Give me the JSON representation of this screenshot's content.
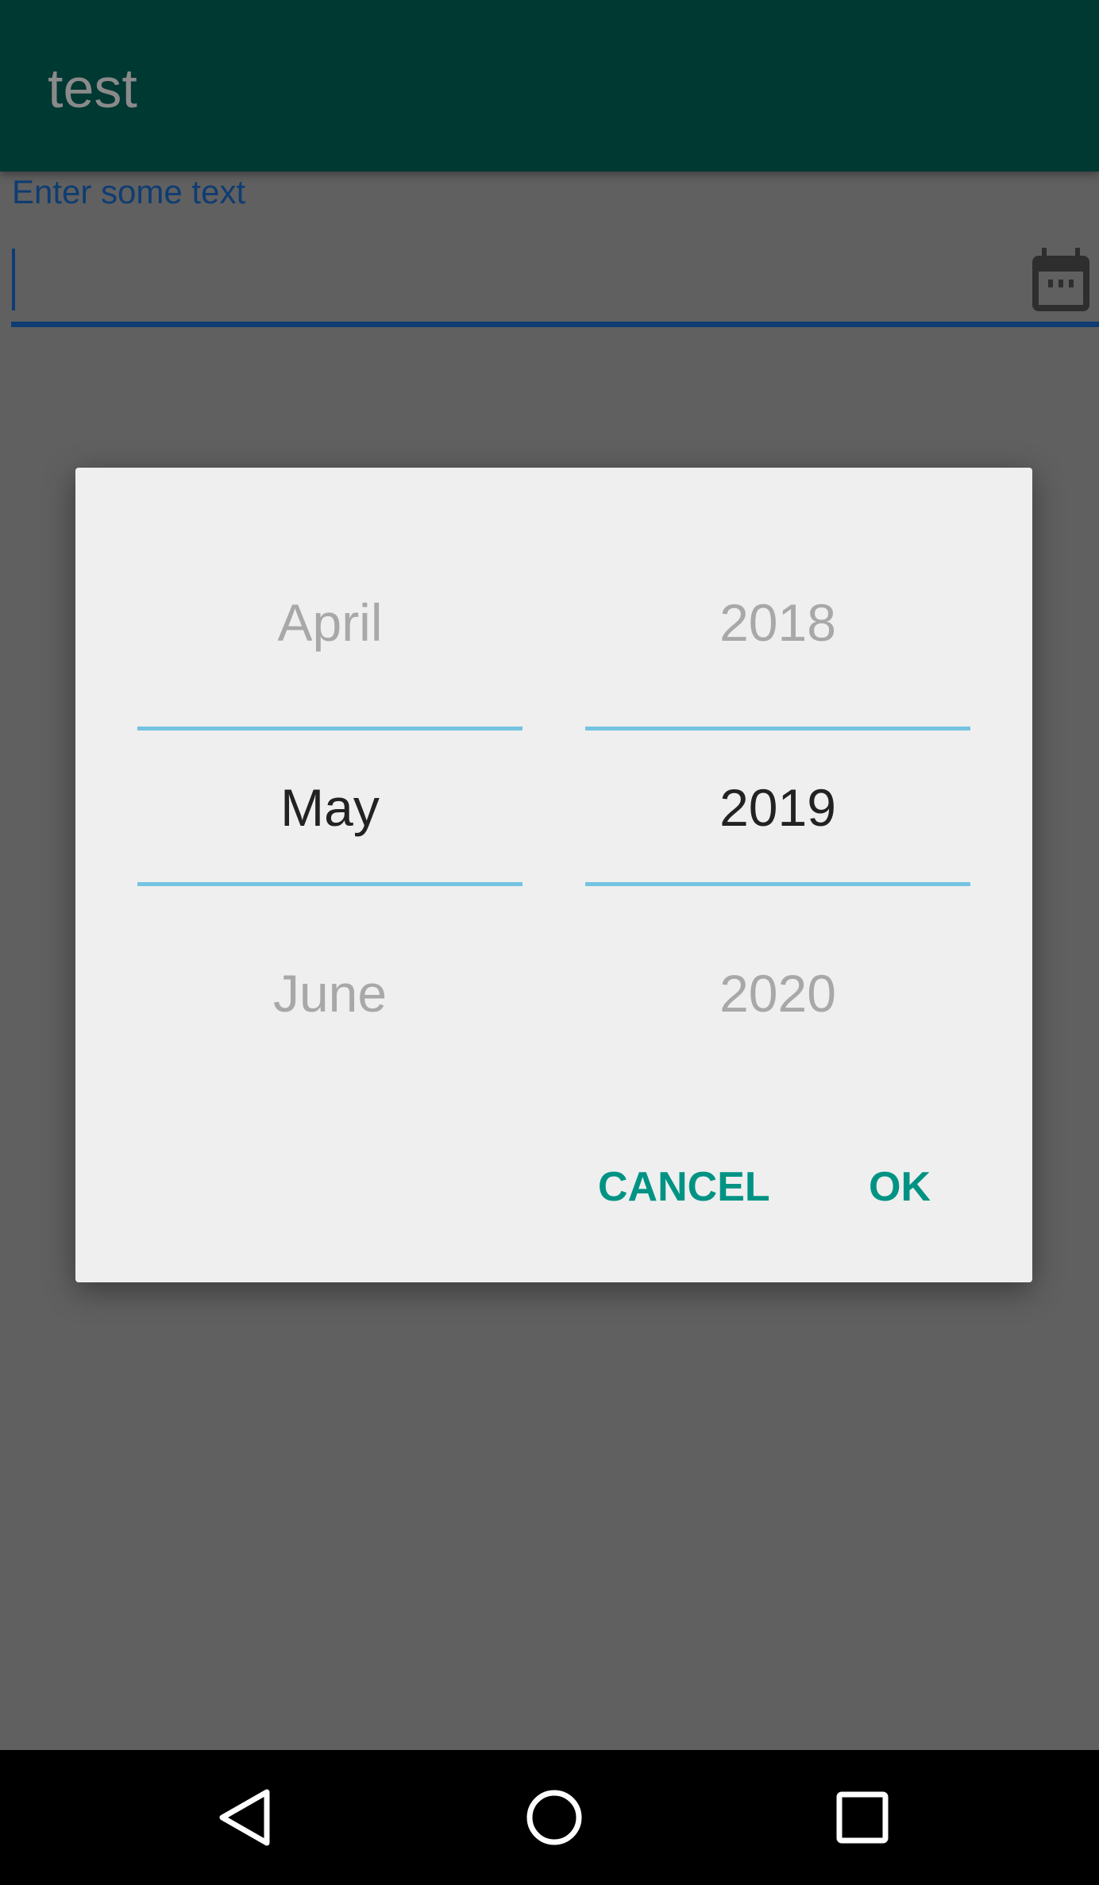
{
  "app_bar": {
    "title": "test"
  },
  "text_field": {
    "label": "Enter some text",
    "value": "",
    "trailing_icon": "calendar-icon"
  },
  "dialog": {
    "month_picker": {
      "previous": "April",
      "selected": "May",
      "next": "June"
    },
    "year_picker": {
      "previous": "2018",
      "selected": "2019",
      "next": "2020"
    },
    "cancel_label": "CANCEL",
    "ok_label": "OK"
  },
  "nav_bar": {
    "icons": [
      "back-icon",
      "home-icon",
      "recents-icon"
    ]
  },
  "colors": {
    "app_bar": "#003832",
    "accent": "#009384",
    "divider": "#74c3e1",
    "field": "#0f3c72"
  }
}
